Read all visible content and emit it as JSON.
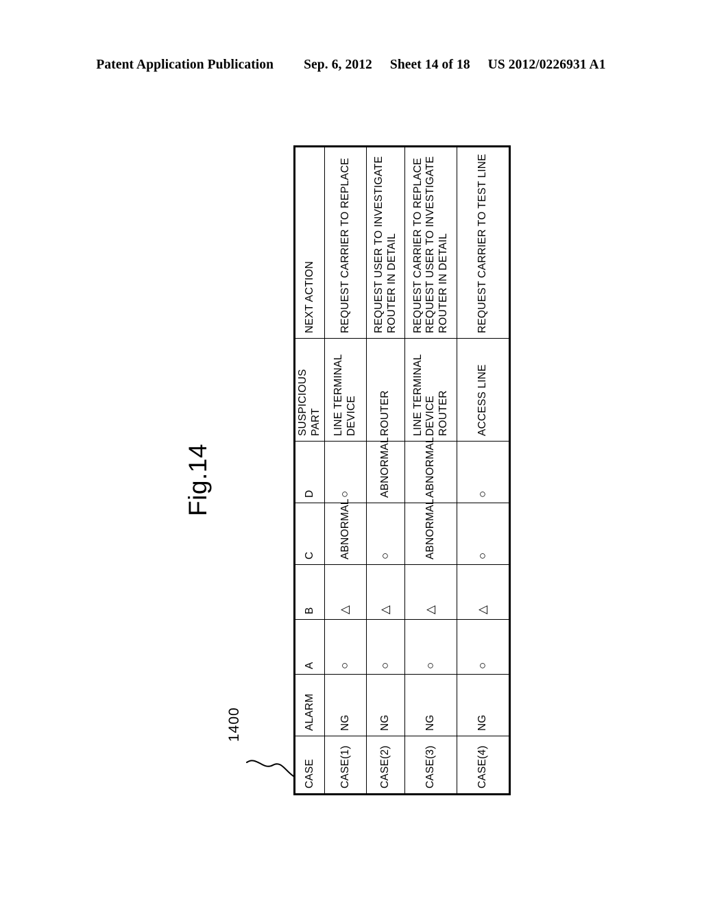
{
  "header": {
    "publication": "Patent Application Publication",
    "date": "Sep. 6, 2012",
    "sheet": "Sheet 14 of 18",
    "doc_number": "US 2012/0226931 A1"
  },
  "figure": {
    "label": "Fig.14",
    "reference_numeral": "1400"
  },
  "table": {
    "columns": [
      {
        "key": "case",
        "header": "CASE"
      },
      {
        "key": "alarm",
        "header": "ALARM"
      },
      {
        "key": "a",
        "header": "A"
      },
      {
        "key": "b",
        "header": "B"
      },
      {
        "key": "c",
        "header": "C"
      },
      {
        "key": "d",
        "header": "D"
      },
      {
        "key": "suspicious_part",
        "header": "SUSPICIOUS\nPART"
      },
      {
        "key": "next_action",
        "header": "NEXT ACTION"
      }
    ],
    "rows": [
      {
        "case": "CASE(1)",
        "alarm": "NG",
        "a": "○",
        "b": "△",
        "c": "ABNORMAL",
        "d": "○",
        "suspicious_part": "LINE TERMINAL\nDEVICE",
        "next_action": "REQUEST CARRIER TO REPLACE"
      },
      {
        "case": "CASE(2)",
        "alarm": "NG",
        "a": "○",
        "b": "△",
        "c": "○",
        "d": "ABNORMAL",
        "suspicious_part": "ROUTER",
        "next_action": "REQUEST USER TO INVESTIGATE\nROUTER IN DETAIL"
      },
      {
        "case": "CASE(3)",
        "alarm": "NG",
        "a": "○",
        "b": "△",
        "c": "ABNORMAL",
        "d": "ABNORMAL",
        "suspicious_part": "LINE TERMINAL\nDEVICE\nROUTER",
        "next_action": "REQUEST CARRIER TO REPLACE\nREQUEST USER TO INVESTIGATE\nROUTER IN DETAIL"
      },
      {
        "case": "CASE(4)",
        "alarm": "NG",
        "a": "○",
        "b": "△",
        "c": "○",
        "d": "○",
        "suspicious_part": "ACCESS LINE",
        "next_action": "REQUEST CARRIER TO TEST LINE"
      }
    ]
  }
}
